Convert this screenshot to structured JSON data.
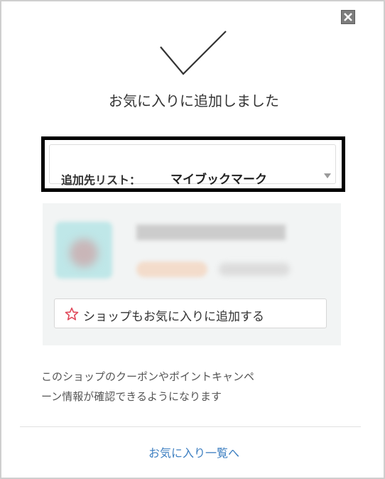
{
  "dialog": {
    "title": "お気に入りに追加しました",
    "close_icon": "close-icon",
    "check_icon": "checkmark-icon"
  },
  "list_select": {
    "label": "追加先リスト：",
    "value": "マイブックマーク",
    "arrow_icon": "chevron-down-icon"
  },
  "shop": {
    "favorite_button_label": "ショップもお気に入りに追加する",
    "star_icon": "star-icon",
    "star_color": "#e0485a"
  },
  "info": {
    "line1": "このショップのクーポンやポイントキャンペ",
    "line2": "ーン情報が確認できるようになります"
  },
  "footer": {
    "link_label": "お気に入り一覧へ",
    "link_color": "#3d7fc1"
  }
}
